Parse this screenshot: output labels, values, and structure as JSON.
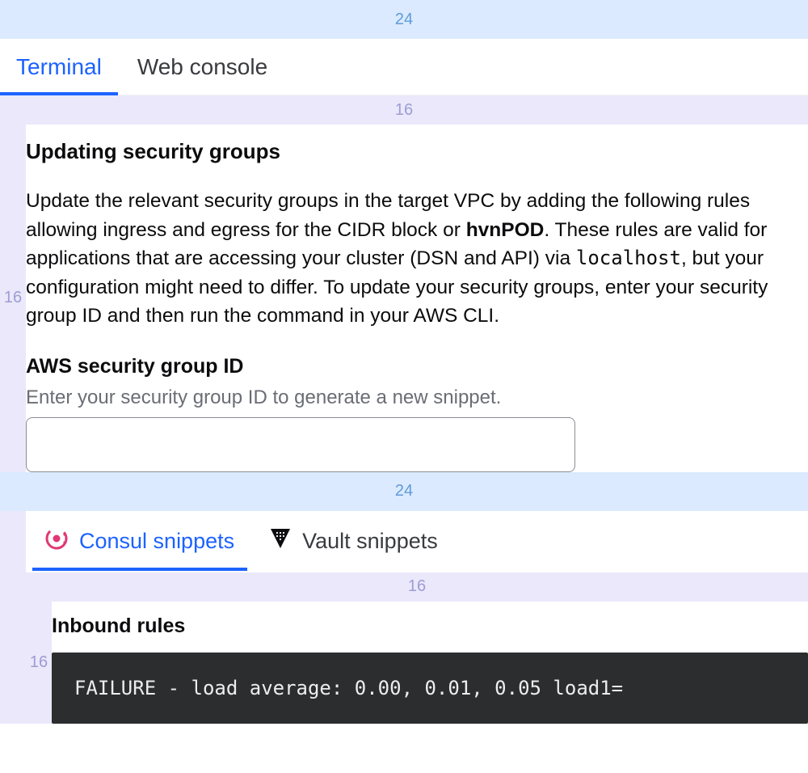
{
  "spacers": {
    "s24": "24",
    "s16": "16"
  },
  "tabs": [
    {
      "label": "Terminal",
      "active": true
    },
    {
      "label": "Web console",
      "active": false
    }
  ],
  "section": {
    "title": "Updating security groups",
    "body_pre": "Update the relevant security groups in the target VPC by adding the following rules allowing ingress and egress for the CIDR block or ",
    "body_bold": "hvnPOD",
    "body_mid1": ". These rules are valid for applications that are accessing your cluster (DSN and API) via ",
    "body_code": "localhost",
    "body_post": ", but your configuration might need to differ. To update your security groups, enter your security group ID and then run the command in your AWS CLI."
  },
  "field": {
    "label": "AWS security group ID",
    "help": "Enter your security group ID to generate a new snippet.",
    "value": ""
  },
  "subtabs": [
    {
      "label": "Consul snippets",
      "icon": "consul",
      "active": true
    },
    {
      "label": "Vault snippets",
      "icon": "vault",
      "active": false
    }
  ],
  "inner": {
    "heading": "Inbound rules",
    "code": "FAILURE - load average: 0.00, 0.01, 0.05 load1="
  }
}
